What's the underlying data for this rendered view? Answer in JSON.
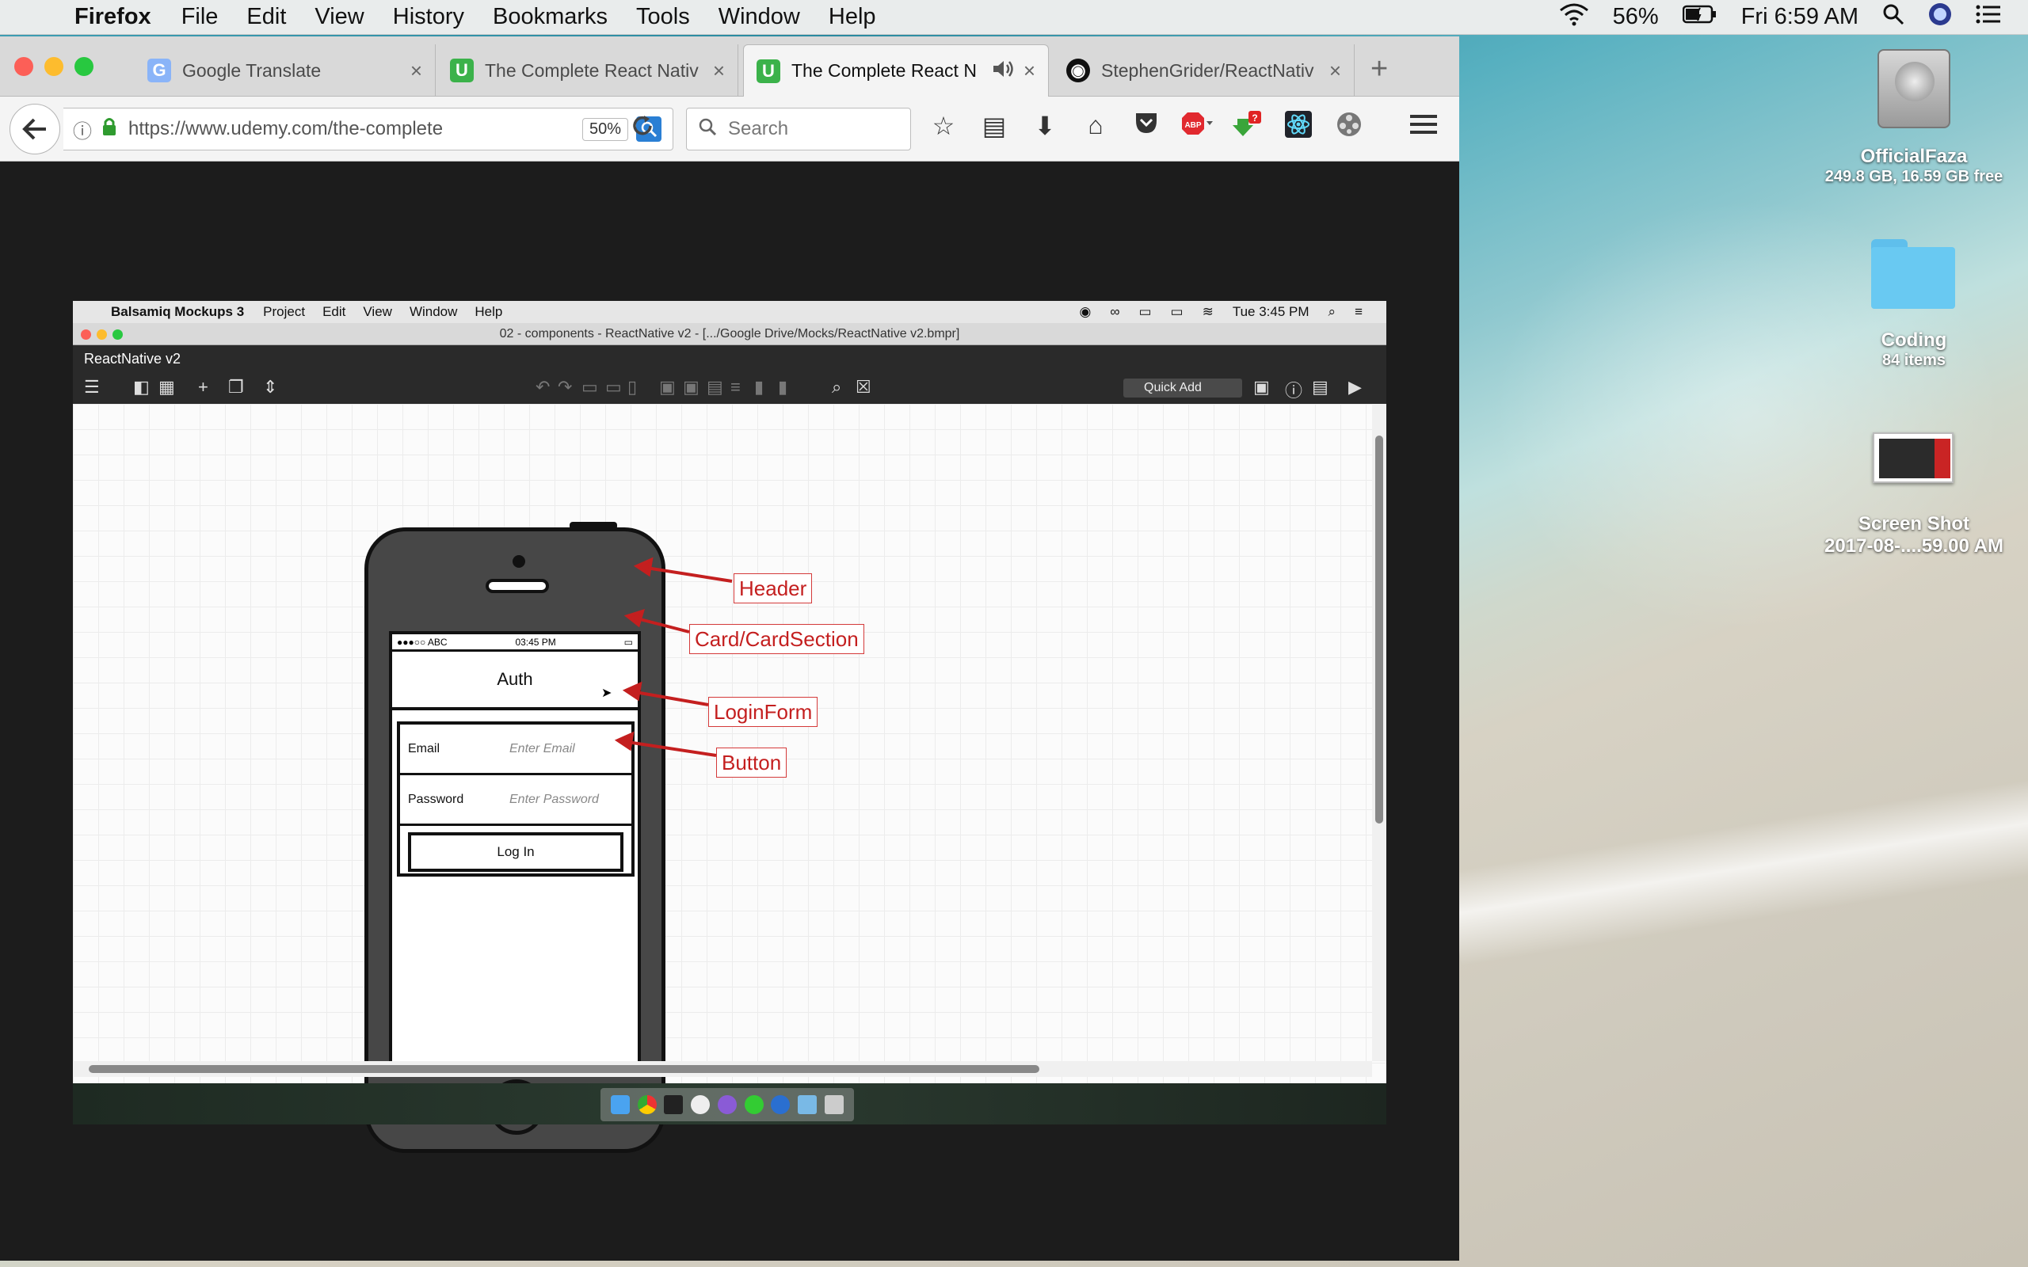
{
  "os_menubar": {
    "app": "Firefox",
    "menus": [
      "File",
      "Edit",
      "View",
      "History",
      "Bookmarks",
      "Tools",
      "Window",
      "Help"
    ],
    "battery": "56%",
    "clock": "Fri 6:59 AM"
  },
  "browser": {
    "tabs": [
      {
        "label": "Google Translate",
        "icon": "google-translate-icon",
        "color": "#8ab4f8"
      },
      {
        "label": "The Complete React Nativ",
        "icon": "udemy-icon",
        "color": "#3bb24a"
      },
      {
        "label": "The Complete React N",
        "icon": "udemy-icon",
        "color": "#3bb24a",
        "active": true
      },
      {
        "label": "StephenGrider/ReactNativ",
        "icon": "github-icon",
        "color": "#111111"
      }
    ],
    "url": "https://www.udemy.com/the-complete",
    "zoom": "50%",
    "search_placeholder": "Search"
  },
  "balsamiq": {
    "app": "Balsamiq Mockups 3",
    "menus": [
      "Project",
      "Edit",
      "View",
      "Window",
      "Help"
    ],
    "clock": "Tue 3:45 PM",
    "window_title": "02 - components - ReactNative v2 - [.../Google Drive/Mocks/ReactNative v2.bmpr]",
    "project": "ReactNative v2",
    "quick_add": "Quick Add"
  },
  "mockup": {
    "carrier": "●●●○○ ABC",
    "time": "03:45 PM",
    "header": "Auth",
    "email_label": "Email",
    "email_placeholder": "Enter Email",
    "password_label": "Password",
    "password_placeholder": "Enter Password",
    "button": "Log In"
  },
  "annotations": {
    "header": "Header",
    "card": "Card/CardSection",
    "login_form": "LoginForm",
    "button": "Button"
  },
  "desktop": {
    "drive_name": "OfficialFaza",
    "drive_info": "249.8 GB, 16.59 GB free",
    "folder_name": "Coding",
    "folder_info": "84 items",
    "shot_name": "Screen Shot",
    "shot_info": "2017-08-....59.00 AM"
  },
  "colors": {
    "annotation": "#c41f1f",
    "accent": "#2a7fd4"
  }
}
